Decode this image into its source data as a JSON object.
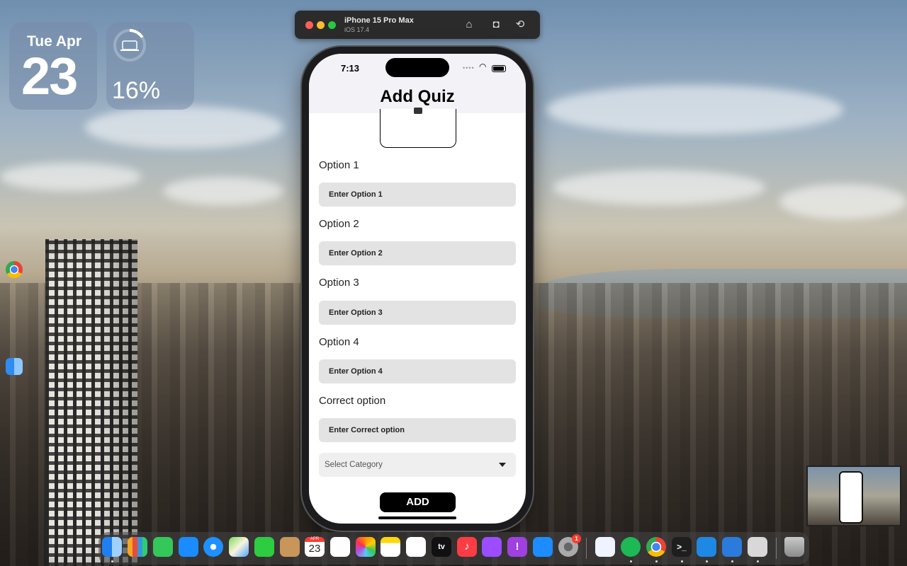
{
  "widgets": {
    "date": {
      "weekday_month": "Tue Apr",
      "day": "23"
    },
    "battery": {
      "percent_label": "16%",
      "level": 0.16
    }
  },
  "simulator": {
    "device_name": "iPhone 15 Pro Max",
    "os_version": "iOS 17.4",
    "buttons": [
      "home-icon",
      "screenshot-icon",
      "rotate-icon"
    ]
  },
  "app": {
    "status_time": "7:13",
    "title": "Add Quiz",
    "fields": [
      {
        "label": "Option 1",
        "placeholder": "Enter Option 1"
      },
      {
        "label": "Option 2",
        "placeholder": "Enter Option 2"
      },
      {
        "label": "Option 3",
        "placeholder": "Enter Option 3"
      },
      {
        "label": "Option 4",
        "placeholder": "Enter Option 4"
      },
      {
        "label": "Correct option",
        "placeholder": "Enter Correct option"
      }
    ],
    "category_select": {
      "placeholder": "Select Category"
    },
    "add_button": "ADD"
  },
  "dock": {
    "apps": [
      "Finder",
      "Launchpad",
      "Messages",
      "Mail",
      "Safari",
      "Maps",
      "FaceTime",
      "Contacts",
      "Calendar",
      "Reminders",
      "Photos",
      "Notes",
      "Freeform",
      "Apple TV",
      "Music",
      "Podcasts",
      "Feedback Assistant",
      "App Store",
      "System Settings",
      "Instruments",
      "Spotify",
      "Chrome",
      "Terminal",
      "VS Code",
      "Xcode",
      "Preview",
      "Trash"
    ],
    "calendar_month": "APR",
    "calendar_day": "23",
    "settings_badge": "1",
    "tv_label": "tv"
  },
  "colors": {
    "accent": "#000000",
    "input_bg": "#e3e3e3",
    "nav_bg": "#f2f2f7"
  }
}
